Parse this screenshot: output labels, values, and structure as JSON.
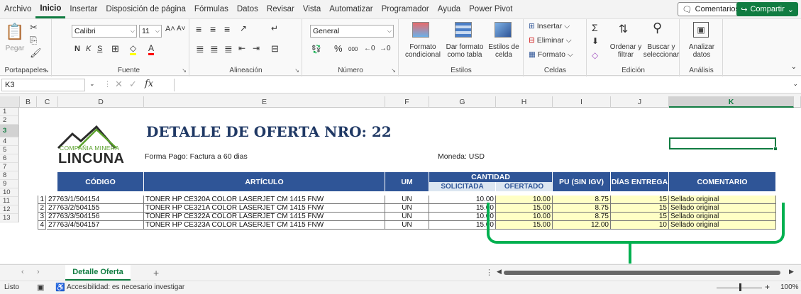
{
  "menu": [
    "Archivo",
    "Inicio",
    "Insertar",
    "Disposición de página",
    "Fórmulas",
    "Datos",
    "Revisar",
    "Vista",
    "Automatizar",
    "Programador",
    "Ayuda",
    "Power Pivot"
  ],
  "menu_active": "Inicio",
  "comments_label": "Comentarios",
  "share_label": "Compartir",
  "ribbon": {
    "portapapeles": {
      "paste": "Pegar",
      "label": "Portapapeles"
    },
    "fuente": {
      "font": "Calibri",
      "size": "11",
      "bold": "N",
      "italic": "K",
      "underline": "S",
      "label": "Fuente"
    },
    "alineacion": {
      "label": "Alineación"
    },
    "numero": {
      "format": "General",
      "label": "Número",
      "pct": "%",
      "thousands": "000"
    },
    "estilos": {
      "cond": "Formato condicional",
      "table": "Dar formato como tabla",
      "cell": "Estilos de celda",
      "label": "Estilos"
    },
    "celdas": {
      "insert": "Insertar",
      "delete": "Eliminar",
      "format": "Formato",
      "label": "Celdas"
    },
    "edicion": {
      "sort": "Ordenar y filtrar",
      "find": "Buscar y seleccionar",
      "label": "Edición"
    },
    "analisis": {
      "analyze": "Analizar datos",
      "label": "Análisis"
    }
  },
  "namebox": "K3",
  "fx": "fx",
  "columns": [
    "B",
    "C",
    "D",
    "E",
    "F",
    "G",
    "H",
    "I",
    "J",
    "K"
  ],
  "rows": [
    "1",
    "2",
    "3",
    "4",
    "5",
    "6",
    "7",
    "8",
    "9",
    "10",
    "11",
    "12",
    "13"
  ],
  "logo": {
    "sub": "COMPAÑIA MINERA",
    "main": "LINCUNA"
  },
  "title": "DETALLE DE OFERTA NRO: 22",
  "forma_pago": "Forma Pago: Factura a  60 dias",
  "moneda": "Moneda: USD",
  "table": {
    "headers": {
      "codigo": "CÓDIGO",
      "articulo": "ARTÍCULO",
      "um": "UM",
      "cantidad": "CANTIDAD",
      "solicitada": "SOLICITADA",
      "ofertado": "OFERTADO",
      "pu": "PU (SIN IGV)",
      "dias": "DÍAS ENTREGA",
      "comentario": "COMENTARIO"
    },
    "rows": [
      {
        "n": "1",
        "codigo": "27763/1/504154",
        "articulo": "TONER HP CE320A COLOR LASERJET CM 1415 FNW",
        "um": "UN",
        "solicitada": "10.00",
        "ofertado": "10.00",
        "pu": "8.75",
        "dias": "15",
        "comentario": "Sellado original"
      },
      {
        "n": "2",
        "codigo": "27763/2/504155",
        "articulo": "TONER HP CE321A COLOR LASERJET CM 1415 FNW",
        "um": "UN",
        "solicitada": "15.00",
        "ofertado": "15.00",
        "pu": "8.75",
        "dias": "15",
        "comentario": "Sellado original"
      },
      {
        "n": "3",
        "codigo": "27763/3/504156",
        "articulo": "TONER HP CE322A COLOR LASERJET CM 1415 FNW",
        "um": "UN",
        "solicitada": "10.00",
        "ofertado": "10.00",
        "pu": "8.75",
        "dias": "15",
        "comentario": "Sellado original"
      },
      {
        "n": "4",
        "codigo": "27763/4/504157",
        "articulo": "TONER HP CE323A COLOR LASERJET CM 1415 FNW",
        "um": "UN",
        "solicitada": "15.00",
        "ofertado": "15.00",
        "pu": "12.00",
        "dias": "10",
        "comentario": "Sellado original"
      }
    ]
  },
  "sheet_tab": "Detalle Oferta",
  "status": {
    "ready": "Listo",
    "accessibility": "Accesibilidad: es necesario investigar",
    "zoom": "100%"
  },
  "colors": {
    "accent": "#107c41",
    "header_blue": "#2f5597",
    "highlight": "#ffffc5",
    "annotation": "#00b050"
  }
}
